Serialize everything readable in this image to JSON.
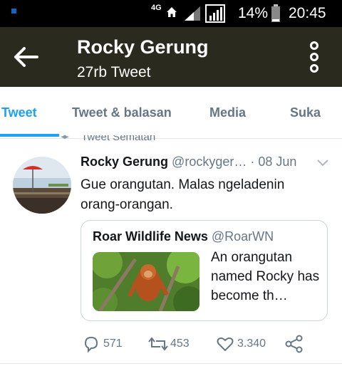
{
  "status_bar": {
    "network": "4G",
    "battery_percent": "14%",
    "time": "20:45"
  },
  "app_bar": {
    "title": "Rocky Gerung",
    "subtitle": "27rb Tweet"
  },
  "tabs": [
    {
      "label": "Tweet",
      "active": true
    },
    {
      "label": "Tweet & balasan",
      "active": false
    },
    {
      "label": "Media",
      "active": false
    },
    {
      "label": "Suka",
      "active": false
    }
  ],
  "tweet": {
    "pinned_label": "Tweet Sematan",
    "author_name": "Rocky Gerung",
    "author_handle": "@rockyger…",
    "date": "· 08 Jun",
    "text": "Gue orangutan. Malas ngeladenin orang-orangan.",
    "quoted": {
      "name": "Roar Wildlife News",
      "handle": "@RoarWN",
      "text": "An orangutan named Rocky has become th…"
    },
    "actions": {
      "replies": "571",
      "retweets": "453",
      "likes": "3.340"
    }
  },
  "colors": {
    "accent": "#1da1f2",
    "app_bar": "#2b2a1f",
    "status_bar": "#000000"
  }
}
